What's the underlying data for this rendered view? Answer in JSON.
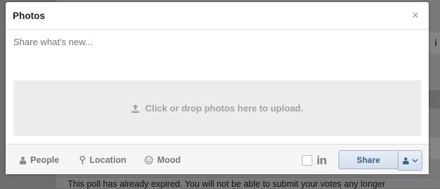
{
  "background": {
    "notice_text": "This poll has already expired. You will not be able to submit your votes any longer",
    "side_marker": "i"
  },
  "modal": {
    "title": "Photos",
    "close_glyph": "×",
    "composer_placeholder": "Share what's new...",
    "dropzone_text": "Click or drop photos here to upload.",
    "footer": {
      "people_label": "People",
      "location_label": "Location",
      "mood_label": "Mood",
      "linkedin_label": "in",
      "linkedin_checked": false,
      "share_label": "Share"
    }
  },
  "colors": {
    "overlay": "#6e6e6e",
    "share_text": "#3f5f86",
    "share_border": "#9fb5cc",
    "dropzone_bg": "#ececec"
  }
}
